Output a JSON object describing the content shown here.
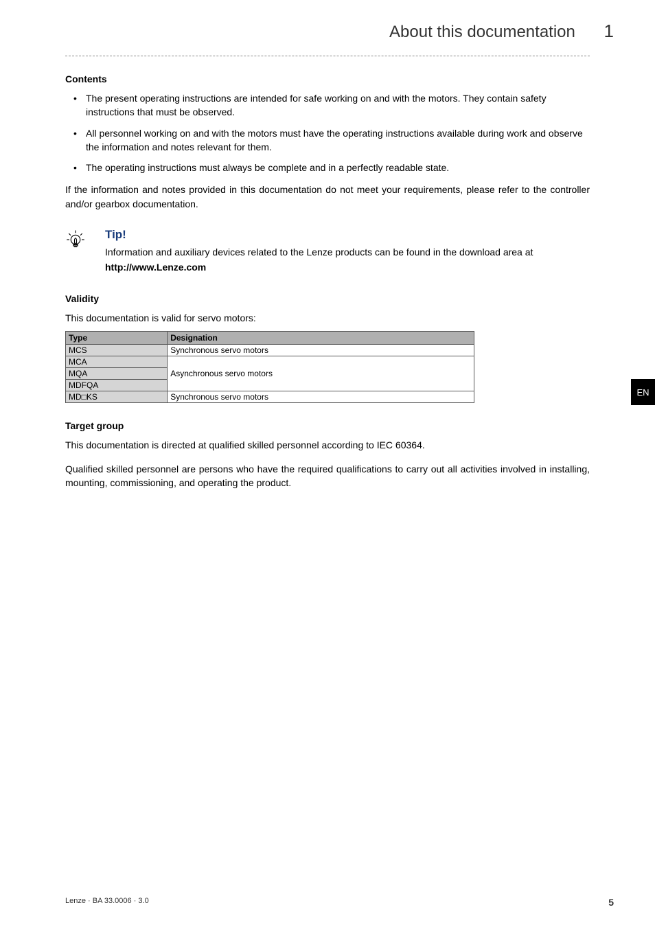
{
  "header": {
    "chapter_title": "About this documentation",
    "chapter_num": "1"
  },
  "sections": {
    "contents": {
      "heading": "Contents",
      "bullets": [
        "The present operating instructions are intended for safe working on and with the motors. They contain safety instructions that must be observed.",
        "All personnel working on and with the motors must have the operating instructions available during work and observe the information and notes relevant for them.",
        "The operating instructions must always be complete and in a perfectly readable state."
      ],
      "after_para": "If the information and notes provided in this documentation do not meet your requirements, please refer to the controller and/or gearbox documentation."
    },
    "tip": {
      "title": "Tip!",
      "text": "Information and auxiliary devices related to the Lenze products can be found in the download area at",
      "link": "http://www.Lenze.com"
    },
    "validity": {
      "heading": "Validity",
      "intro": "This documentation is valid for servo motors:",
      "table": {
        "headers": [
          "Type",
          "Designation"
        ],
        "rows": [
          {
            "type": "MCS",
            "designation": "Synchronous servo motors",
            "rowspan": 1
          },
          {
            "type": "MCA",
            "designation": "Asynchronous servo motors",
            "rowspan": 3,
            "is_first_in_group": true
          },
          {
            "type": "MQA",
            "designation": "",
            "is_first_in_group": false
          },
          {
            "type": "MDFQA",
            "designation": "",
            "is_first_in_group": false
          },
          {
            "type": "MD□KS",
            "designation": "Synchronous servo motors",
            "rowspan": 1
          }
        ]
      }
    },
    "target_group": {
      "heading": "Target group",
      "paras": [
        "This documentation is directed at qualified skilled personnel according to IEC 60364.",
        "Qualified skilled personnel are persons who have the required qualifications to carry out all activities involved in installing, mounting, commissioning, and operating the product."
      ]
    }
  },
  "side_tab": "EN",
  "footer": {
    "left": "Lenze · BA 33.0006 · 3.0",
    "page_num": "5"
  }
}
